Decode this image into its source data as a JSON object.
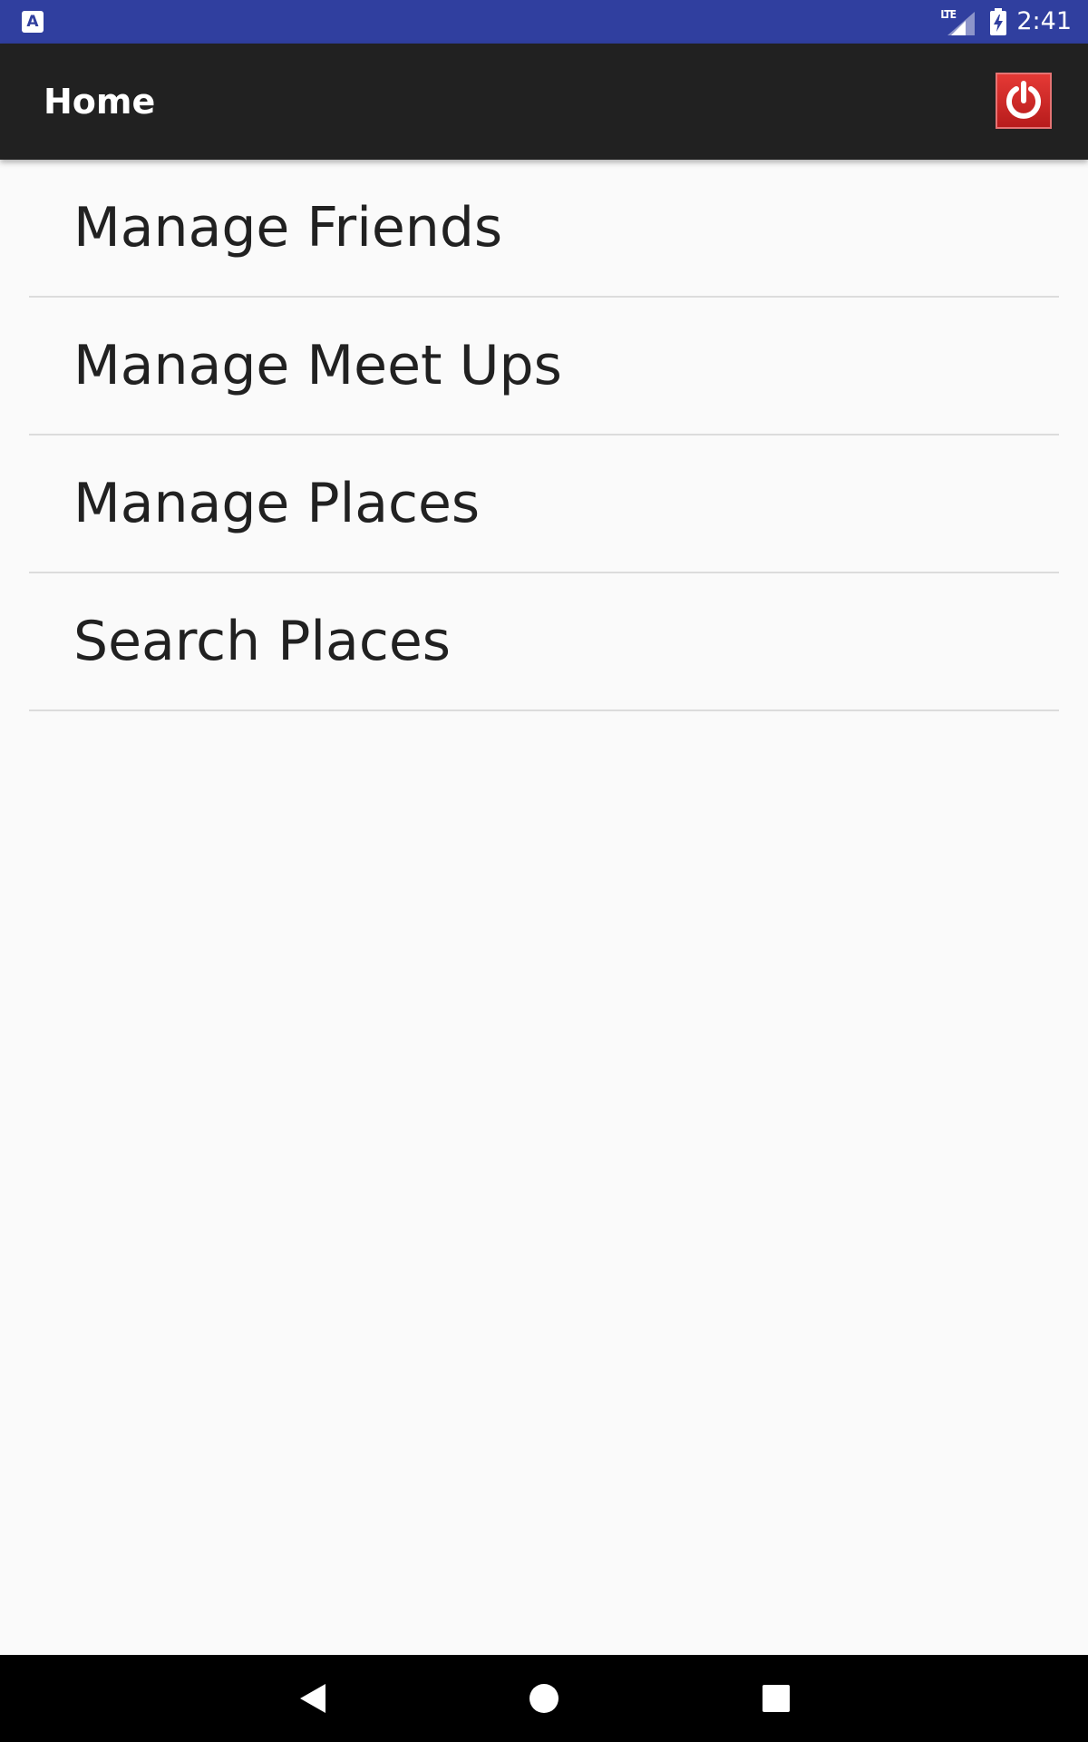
{
  "status_bar": {
    "app_icon": "A",
    "network_label": "LTE",
    "time": "2:41",
    "background_color": "#303f9f"
  },
  "app_bar": {
    "title": "Home",
    "action_icon": "power-icon",
    "action_color": "#d32f2f",
    "background_color": "#212121"
  },
  "menu": {
    "items": [
      {
        "label": "Manage Friends"
      },
      {
        "label": "Manage Meet Ups"
      },
      {
        "label": "Manage Places"
      },
      {
        "label": "Search Places"
      }
    ]
  },
  "nav_bar": {
    "icons": [
      "back-icon",
      "home-icon",
      "recents-icon"
    ]
  }
}
